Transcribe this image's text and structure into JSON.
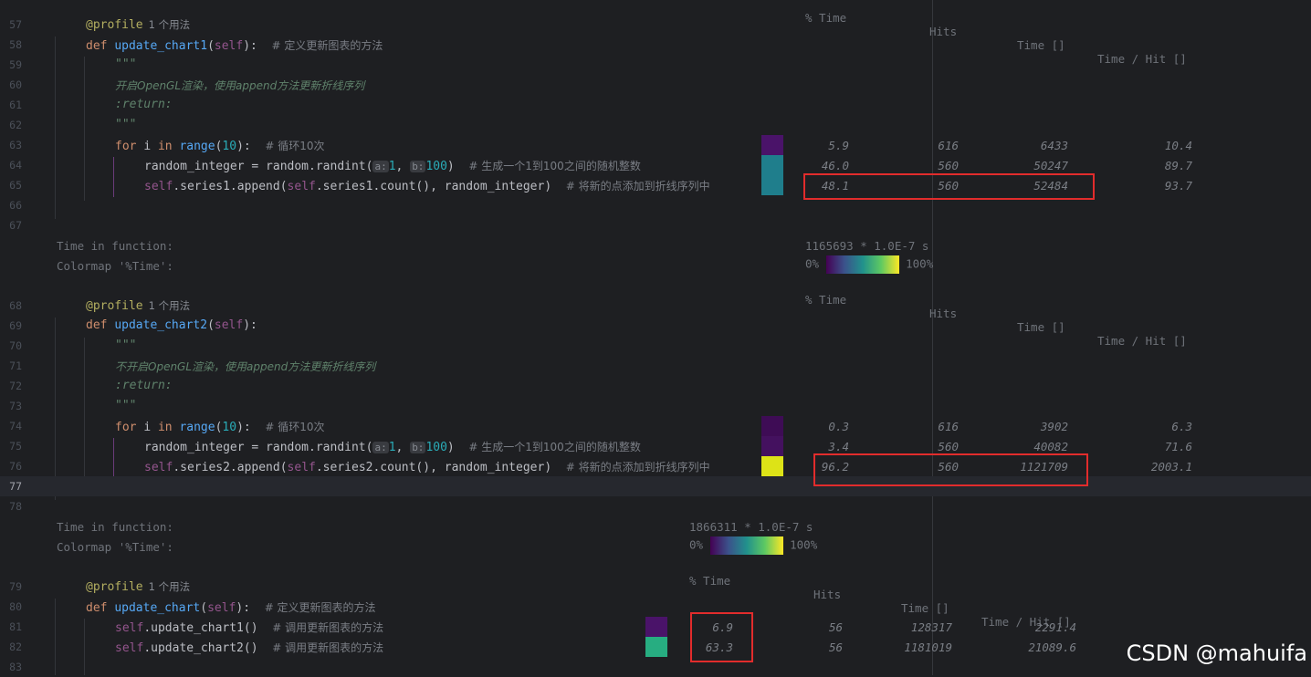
{
  "colors": {
    "background": "#1e1f22",
    "current_line": "#26282e",
    "keyword": "#cf8e6d",
    "function": "#56a8f5",
    "highlight_box": "#e22c2c",
    "colormap_low": "#440154",
    "colormap_high": "#fde725"
  },
  "headers": {
    "pct_time": "% Time",
    "hits": "Hits",
    "time": "Time []",
    "time_per_hit": "Time / Hit []"
  },
  "block1": {
    "time_in_function_label": "Time in function:",
    "time_in_function_value": "1165693 * 1.0E-7 s",
    "colormap_label": "Colormap '%Time':",
    "cmap_low": "0%",
    "cmap_high": "100%"
  },
  "block2": {
    "time_in_function_label": "Time in function:",
    "time_in_function_value": "1866311 * 1.0E-7 s",
    "colormap_label": "Colormap '%Time':",
    "cmap_low": "0%",
    "cmap_high": "100%"
  },
  "code": {
    "decorator": "@profile",
    "usage": "1 个用法",
    "kw_def": "def",
    "kw_for": "for",
    "kw_in": "in",
    "fn_update_chart1": "update_chart1",
    "fn_update_chart2": "update_chart2",
    "fn_update_chart": "update_chart",
    "self": "self",
    "sig_open": "(",
    "sig_close": "):",
    "comment_define1": "# 定义更新图表的方法",
    "doc_quote": "\"\"\"",
    "doc_opengl_on": "开启OpenGL渲染，使用append方法更新折线序列",
    "doc_opengl_off": "不开启OpenGL渲染，使用append方法更新折线序列",
    "doc_return": ":return:",
    "loop_var": "i",
    "range_fn": "range",
    "range_arg": "10",
    "comment_loop": "# 循环10次",
    "randint_prefix": "random_integer = random.randint(",
    "hint_a": "a:",
    "hint_b": "b:",
    "arg_1": "1",
    "arg_100": "100",
    "comma": ", ",
    "close_paren": ")",
    "comment_randint": "# 生成一个1到100之间的随机整数",
    "append1": ".series1.append(",
    "count1": ".series1.count(), random_integer)",
    "append2": ".series2.append(",
    "count2": ".series2.count(), random_integer)",
    "comment_append": "# 将新的点添加到折线序列中",
    "call_chart1": ".update_chart1()",
    "call_chart2": ".update_chart2()",
    "comment_call": "# 调用更新图表的方法"
  },
  "line_numbers": [
    "57",
    "58",
    "59",
    "60",
    "61",
    "62",
    "63",
    "64",
    "65",
    "66",
    "67",
    "68",
    "69",
    "70",
    "71",
    "72",
    "73",
    "74",
    "75",
    "76",
    "77",
    "78",
    "79",
    "80",
    "81",
    "82",
    "83"
  ],
  "stats": {
    "l63": {
      "pct": "5.9",
      "hits": "616",
      "time": "6433",
      "per_hit": "10.4",
      "color": "#4a1369"
    },
    "l64": {
      "pct": "46.0",
      "hits": "560",
      "time": "50247",
      "per_hit": "89.7",
      "color": "#1f7e8c"
    },
    "l65": {
      "pct": "48.1",
      "hits": "560",
      "time": "52484",
      "per_hit": "93.7",
      "color": "#1f7e8c"
    },
    "l74": {
      "pct": "0.3",
      "hits": "616",
      "time": "3902",
      "per_hit": "6.3",
      "color": "#3e0c55"
    },
    "l75": {
      "pct": "3.4",
      "hits": "560",
      "time": "40082",
      "per_hit": "71.6",
      "color": "#44115f"
    },
    "l76": {
      "pct": "96.2",
      "hits": "560",
      "time": "1121709",
      "per_hit": "2003.1",
      "color": "#dde317"
    },
    "l81": {
      "pct": "6.9",
      "hits": "56",
      "time": "128317",
      "per_hit": "2291.4",
      "color": "#4a1369"
    },
    "l82": {
      "pct": "63.3",
      "hits": "56",
      "time": "1181019",
      "per_hit": "21089.6",
      "color": "#27ad81"
    }
  },
  "watermark": "CSDN @mahuifa"
}
